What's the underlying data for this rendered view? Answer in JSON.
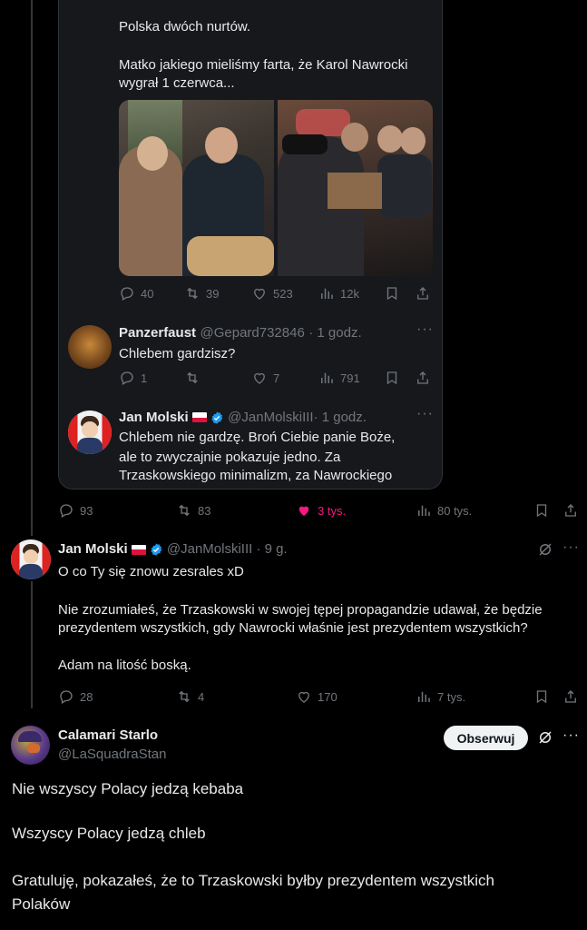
{
  "quoted_post": {
    "line1": "Polska dwóch nurtów.",
    "line2a": "Matko jakiego mieliśmy farta, że Karol Nawrocki",
    "line2b": "wygrał 1 czerwca...",
    "metrics": {
      "replies": "40",
      "reposts": "39",
      "likes": "523",
      "views": "12k"
    }
  },
  "reply_panzer": {
    "name": "Panzerfaust",
    "handle": "@Gepard732846",
    "time": "· 1 godz.",
    "text": "Chlebem gardzisz?",
    "metrics": {
      "replies": "1",
      "reposts": "",
      "likes": "7",
      "views": "791"
    }
  },
  "reply_molski_inner": {
    "name": "Jan Molski",
    "handle": "@JanMolskiIII",
    "time": "· 1 godz.",
    "lines": [
      "Chlebem nie gardzę. Broń Ciebie panie Boże,",
      "ale to zwyczajnie pokazuje jedno. Za",
      "Trzaskowskiego minimalizm, za Nawrockiego"
    ]
  },
  "outer_metrics": {
    "replies": "93",
    "reposts": "83",
    "likes": "3 tys.",
    "views": "80 tys."
  },
  "molski_post": {
    "name": "Jan Molski",
    "handle": "@JanMolskiIII",
    "time": "· 9 g.",
    "p1": "O co Ty się znowu zesrales xD",
    "p2a": "Nie zrozumiałeś, że Trzaskowski w swojej tępej propagandzie udawał, że będzie",
    "p2b": "prezydentem wszystkich, gdy Nawrocki właśnie jest prezydentem wszystkich?",
    "p3": "Adam na litość boską.",
    "metrics": {
      "replies": "28",
      "reposts": "4",
      "likes": "170",
      "views": "7 tys."
    }
  },
  "calamari_post": {
    "name": "Calamari Starlo",
    "handle": "@LaSquadraStan",
    "follow_label": "Obserwuj",
    "p1": "Nie wszyscy Polacy jedzą kebaba",
    "p2": "Wszyscy Polacy jedzą chleb",
    "p3a": "Gratuluję, pokazałeś, że to Trzaskowski byłby prezydentem wszystkich",
    "p3b": "Polaków"
  },
  "colors": {
    "like_active": "#f91880",
    "verified": "#1d9bf0",
    "muted": "#71767b"
  }
}
